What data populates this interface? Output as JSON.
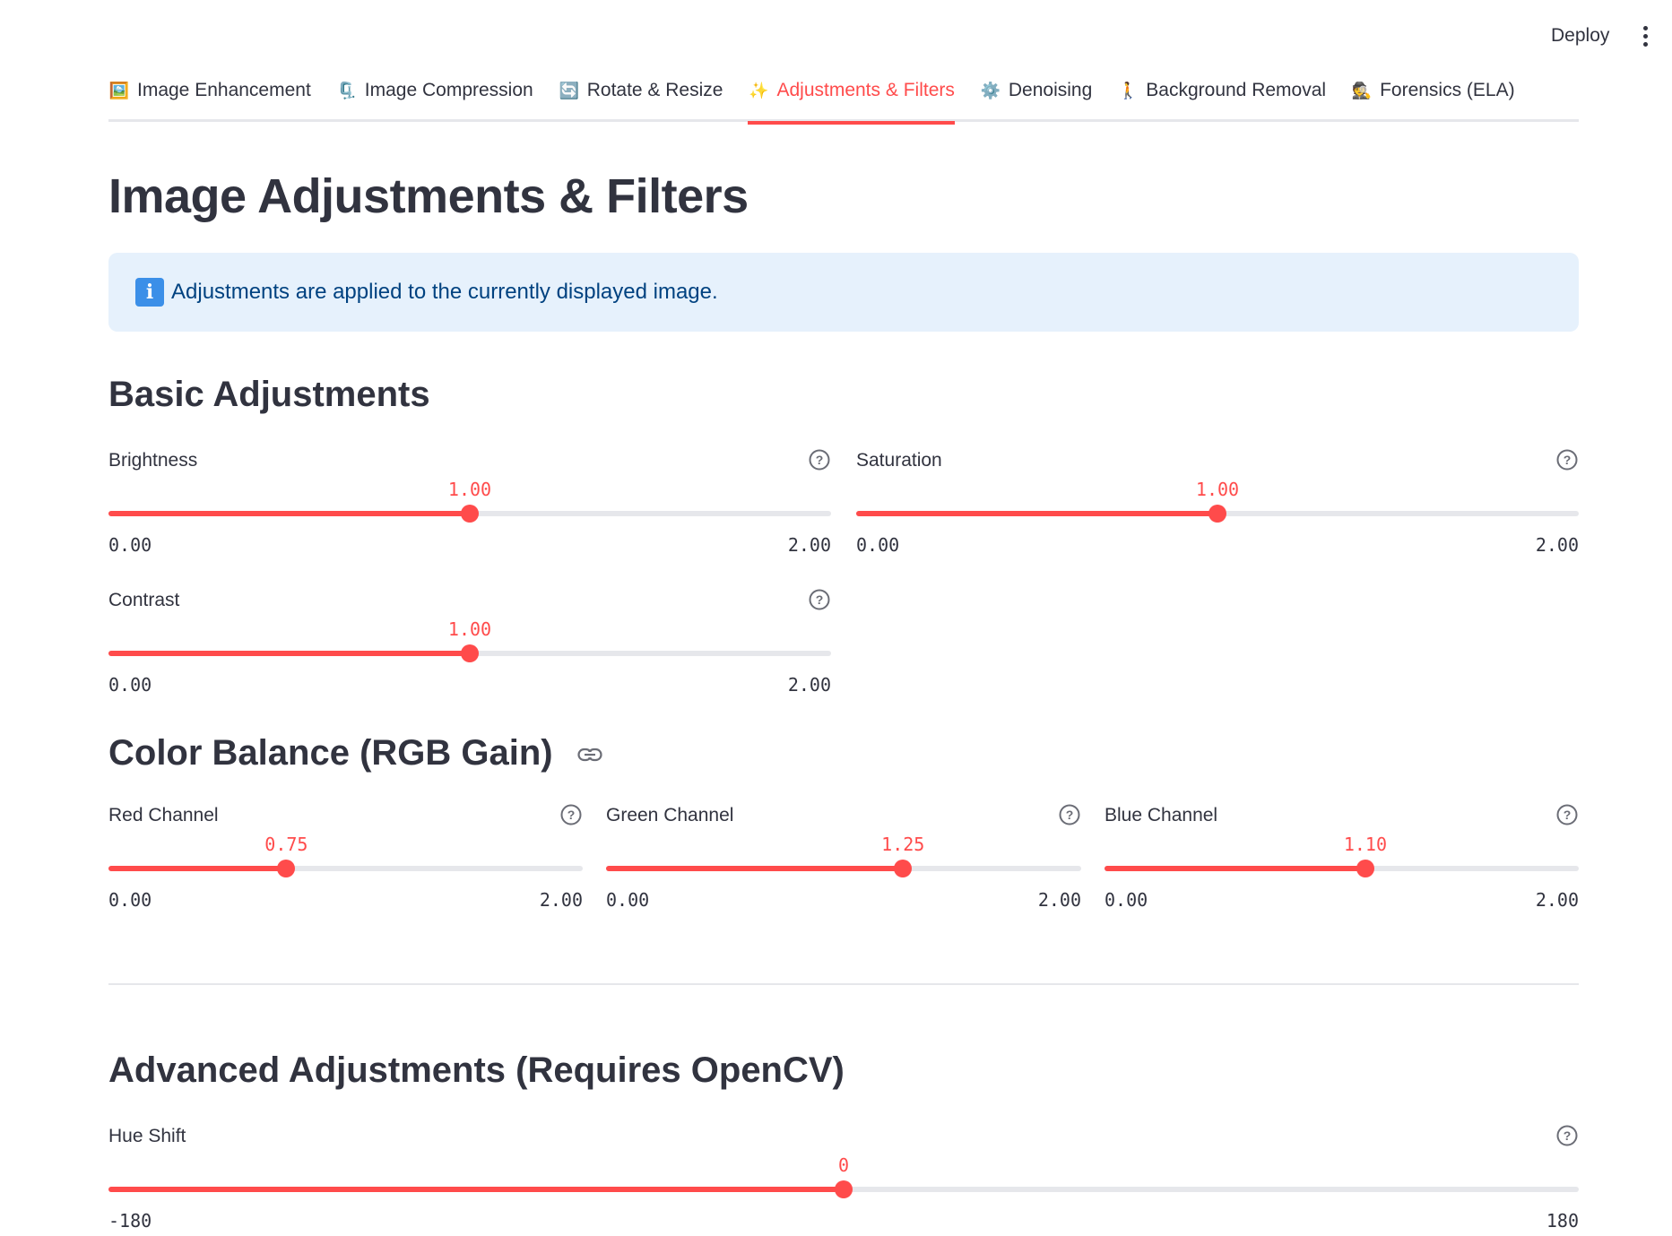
{
  "header": {
    "deploy_label": "Deploy",
    "menu_icon": "more-vertical-icon"
  },
  "tabs": [
    {
      "label": "Image Enhancement",
      "icon": "framed-picture-icon",
      "glyph": "🖼️",
      "active": false
    },
    {
      "label": "Image Compression",
      "icon": "clamp-icon",
      "glyph": "🗜️",
      "active": false
    },
    {
      "label": "Rotate & Resize",
      "icon": "arrows-rotate-icon",
      "glyph": "🔄",
      "active": false
    },
    {
      "label": "Adjustments & Filters",
      "icon": "sparkles-icon",
      "glyph": "✨",
      "active": true
    },
    {
      "label": "Denoising",
      "icon": "gear-icon",
      "glyph": "⚙️",
      "active": false
    },
    {
      "label": "Background Removal",
      "icon": "person-walking-icon",
      "glyph": "🚶",
      "active": false
    },
    {
      "label": "Forensics (ELA)",
      "icon": "detective-icon",
      "glyph": "🕵️",
      "active": false
    }
  ],
  "page": {
    "title": "Image Adjustments & Filters",
    "info": "Adjustments are applied to the currently displayed image.",
    "info_icon": "information-icon"
  },
  "sections": {
    "basic": "Basic Adjustments",
    "color": "Color Balance (RGB Gain)",
    "advanced": "Advanced Adjustments (Requires OpenCV)"
  },
  "sliders": {
    "brightness": {
      "label": "Brightness",
      "value": "1.00",
      "min": "0.00",
      "max": "2.00",
      "fraction": 0.5
    },
    "saturation": {
      "label": "Saturation",
      "value": "1.00",
      "min": "0.00",
      "max": "2.00",
      "fraction": 0.5
    },
    "contrast": {
      "label": "Contrast",
      "value": "1.00",
      "min": "0.00",
      "max": "2.00",
      "fraction": 0.5
    },
    "red": {
      "label": "Red Channel",
      "value": "0.75",
      "min": "0.00",
      "max": "2.00",
      "fraction": 0.375
    },
    "green": {
      "label": "Green Channel",
      "value": "1.25",
      "min": "0.00",
      "max": "2.00",
      "fraction": 0.625
    },
    "blue": {
      "label": "Blue Channel",
      "value": "1.10",
      "min": "0.00",
      "max": "2.00",
      "fraction": 0.55
    },
    "hue": {
      "label": "Hue Shift",
      "value": "0",
      "min": "-180",
      "max": "180",
      "fraction": 0.5
    }
  },
  "colors": {
    "accent": "#ff4b4b",
    "text": "#31333f",
    "info_bg": "#e6f1fc",
    "info_text": "#004280",
    "track": "#e6e7eb"
  }
}
